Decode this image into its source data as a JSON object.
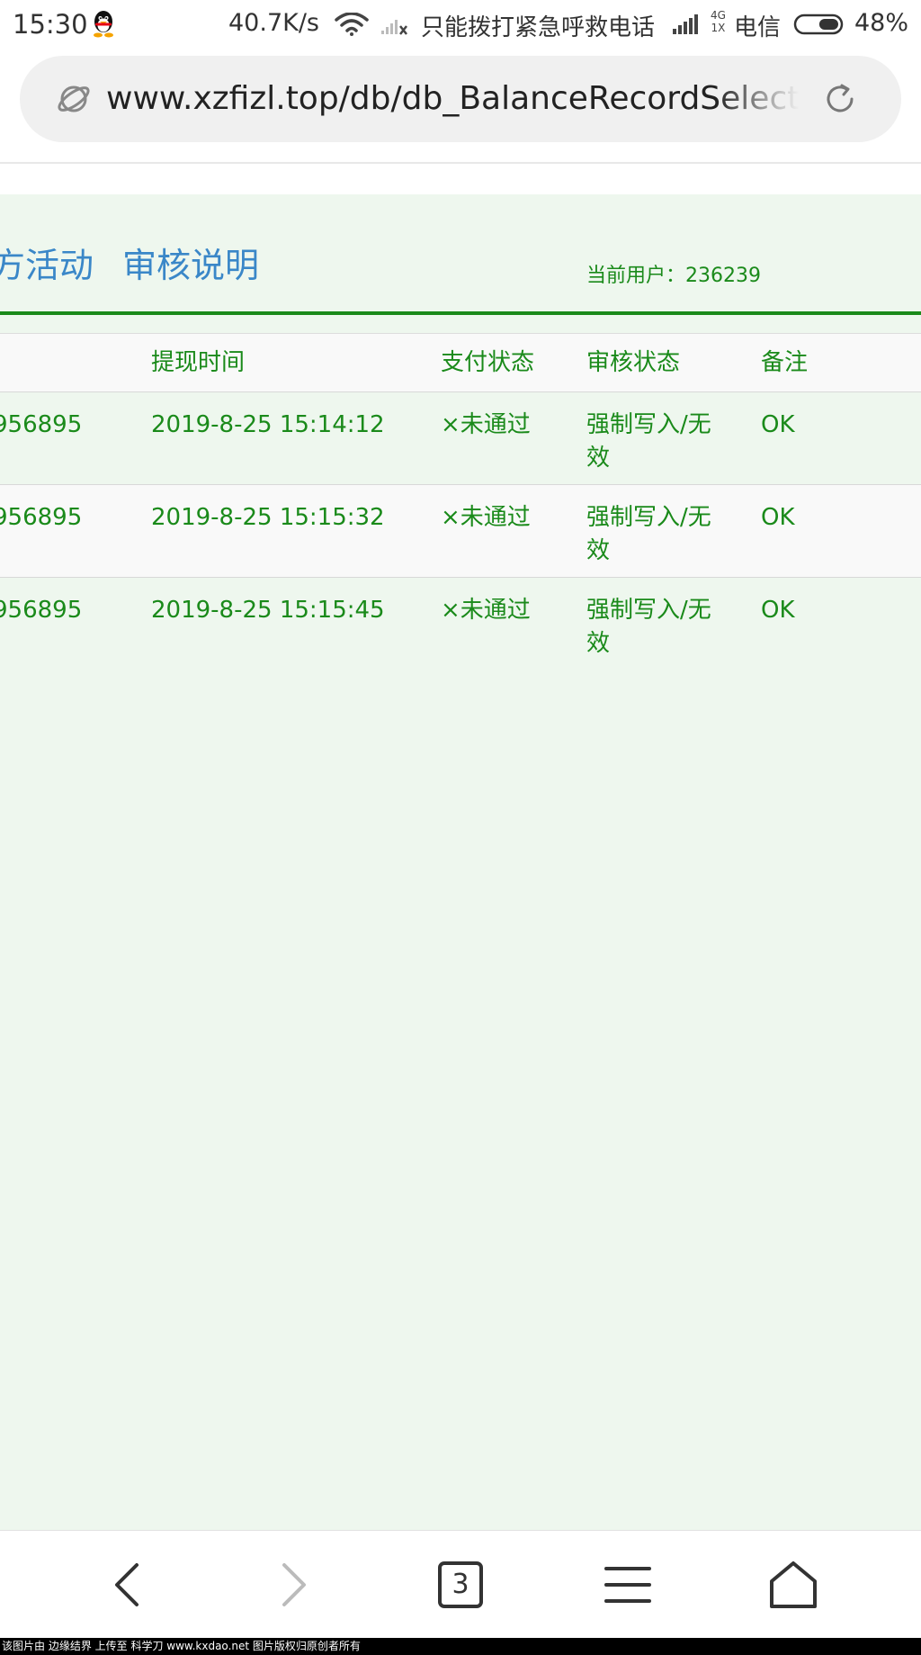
{
  "status_bar": {
    "time": "15:30",
    "speed": "40.7K/s",
    "emergency": "只能拨打紧急呼救电话",
    "network_top": "4G",
    "network_bottom": "1X",
    "carrier": "电信",
    "battery": "48%",
    "battery_level": 0.48
  },
  "browser": {
    "url": "www.xzfizl.top/db/db_BalanceRecordSelect.php",
    "tab_count": "3"
  },
  "page": {
    "nav_links": [
      "方活动",
      "审核说明"
    ],
    "current_user": "当前用户：236239"
  },
  "table": {
    "headers": [
      "提现时间",
      "支付状态",
      "审核状态",
      "备注"
    ],
    "rows": [
      {
        "account": "956895",
        "time": "2019-8-25 15:14:12",
        "pay_status": "×未通过",
        "audit_status": "强制写入/无效",
        "note": "OK"
      },
      {
        "account": "956895",
        "time": "2019-8-25 15:15:32",
        "pay_status": "×未通过",
        "audit_status": "强制写入/无效",
        "note": "OK"
      },
      {
        "account": "956895",
        "time": "2019-8-25 15:15:45",
        "pay_status": "×未通过",
        "audit_status": "强制写入/无效",
        "note": "OK"
      }
    ]
  },
  "watermark": "该图片由 边缘结界 上传至 科学刀 www.kxdao.net 图片版权归原创者所有",
  "colors": {
    "link_blue": "#3a87c8",
    "text_green": "#1a8a1a",
    "page_bg": "#eef7ee"
  }
}
